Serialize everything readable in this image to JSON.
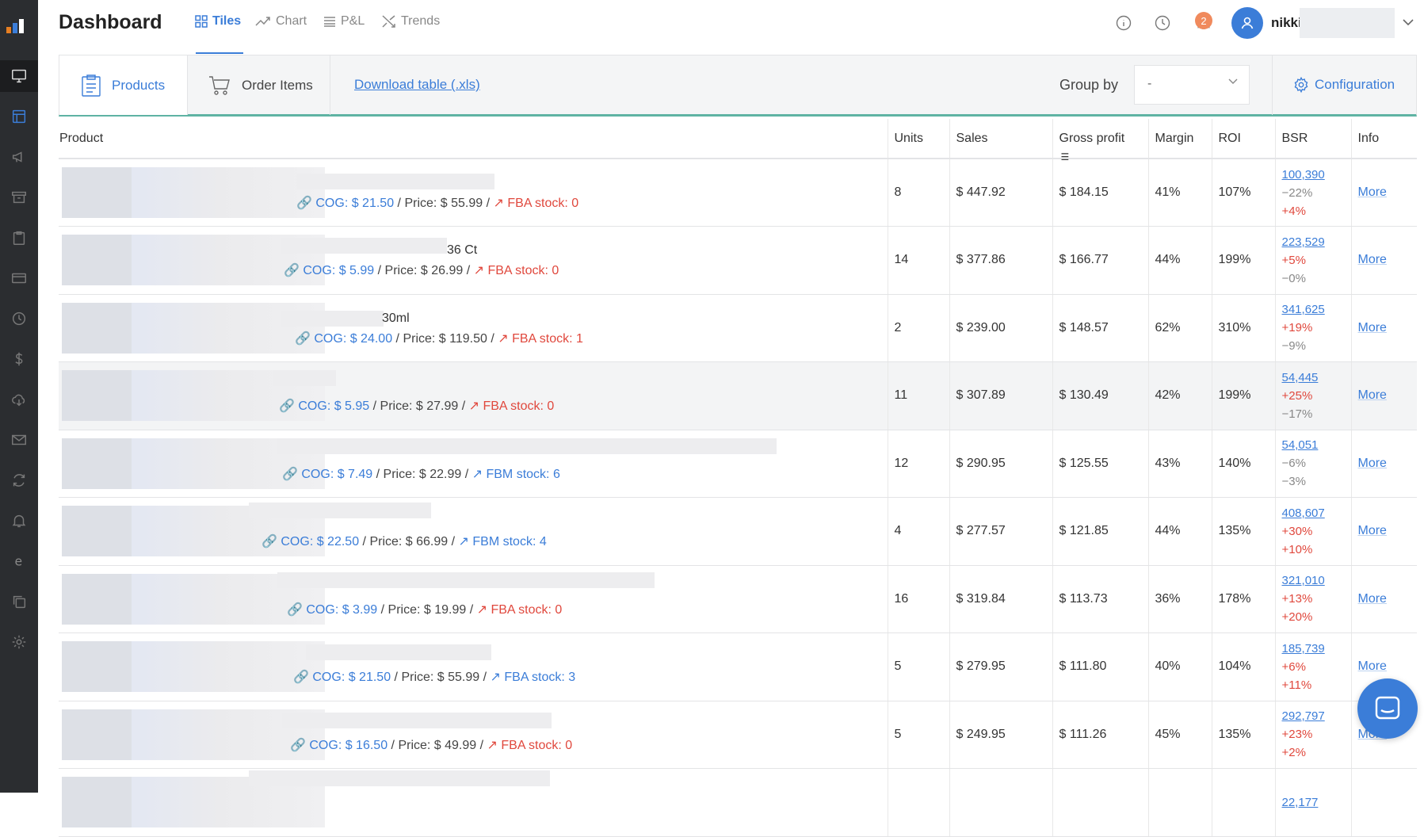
{
  "header": {
    "title": "Dashboard",
    "tabs": [
      {
        "label": "Tiles",
        "icon": "tiles-icon",
        "active": true
      },
      {
        "label": "Chart",
        "icon": "chart-icon"
      },
      {
        "label": "P&L",
        "icon": "list-icon"
      },
      {
        "label": "Trends",
        "icon": "trends-icon"
      }
    ],
    "notifications_count": "2",
    "user_name": "nikki"
  },
  "toolbar": {
    "tab_products": "Products",
    "tab_order_items": "Order Items",
    "download_label": "Download table (.xls)",
    "group_by_label": "Group by",
    "group_by_value": "-",
    "configuration_label": "Configuration"
  },
  "table": {
    "columns": [
      "Product",
      "Units",
      "Sales",
      "Gross profit",
      "Margin",
      "ROI",
      "BSR",
      "Info"
    ],
    "rows": [
      {
        "name_suffix": "",
        "cog": "COG: $ 21.50",
        "price": "/ Price: $ 55.99 /",
        "stock": "FBA stock: 0",
        "stock_color": "red",
        "units": "8",
        "sales": "$ 447.92",
        "gross": "$ 184.15",
        "margin": "41%",
        "roi": "107%",
        "bsr": "100,390",
        "bsr1": "−22%",
        "bsr2": "+4%",
        "info": "More"
      },
      {
        "name_suffix": "36 Ct",
        "cog": "COG: $ 5.99",
        "price": "/ Price: $ 26.99 /",
        "stock": "FBA stock: 0",
        "stock_color": "red",
        "units": "14",
        "sales": "$ 377.86",
        "gross": "$ 166.77",
        "margin": "44%",
        "roi": "199%",
        "bsr": "223,529",
        "bsr1": "+5%",
        "bsr2": "−0%",
        "info": "More"
      },
      {
        "name_suffix": "30ml",
        "cog": "COG: $ 24.00",
        "price": "/ Price: $ 119.50 /",
        "stock": "FBA stock: 1",
        "stock_color": "red",
        "units": "2",
        "sales": "$ 239.00",
        "gross": "$ 148.57",
        "margin": "62%",
        "roi": "310%",
        "bsr": "341,625",
        "bsr1": "+19%",
        "bsr2": "−9%",
        "info": "More"
      },
      {
        "name_suffix": "",
        "cog": "COG: $ 5.95",
        "price": "/ Price: $ 27.99 /",
        "stock": "FBA stock: 0",
        "stock_color": "red",
        "units": "11",
        "sales": "$ 307.89",
        "gross": "$ 130.49",
        "margin": "42%",
        "roi": "199%",
        "bsr": "54,445",
        "bsr1": "+25%",
        "bsr2": "−17%",
        "info": "More"
      },
      {
        "name_suffix": "",
        "cog": "COG: $ 7.49",
        "price": "/ Price: $ 22.99 /",
        "stock": "FBM stock: 6",
        "stock_color": "blue",
        "units": "12",
        "sales": "$ 290.95",
        "gross": "$ 125.55",
        "margin": "43%",
        "roi": "140%",
        "bsr": "54,051",
        "bsr1": "−6%",
        "bsr2": "−3%",
        "info": "More"
      },
      {
        "name_suffix": "",
        "cog": "COG: $ 22.50",
        "price": "/ Price: $ 66.99 /",
        "stock": "FBM stock: 4",
        "stock_color": "blue",
        "units": "4",
        "sales": "$ 277.57",
        "gross": "$ 121.85",
        "margin": "44%",
        "roi": "135%",
        "bsr": "408,607",
        "bsr1": "+30%",
        "bsr2": "+10%",
        "info": "More"
      },
      {
        "name_suffix": "",
        "cog": "COG: $ 3.99",
        "price": "/ Price: $ 19.99 /",
        "stock": "FBA stock: 0",
        "stock_color": "red",
        "units": "16",
        "sales": "$ 319.84",
        "gross": "$ 113.73",
        "margin": "36%",
        "roi": "178%",
        "bsr": "321,010",
        "bsr1": "+13%",
        "bsr2": "+20%",
        "info": "More"
      },
      {
        "name_suffix": "",
        "cog": "COG: $ 21.50",
        "price": "/ Price: $ 55.99 /",
        "stock": "FBA stock: 3",
        "stock_color": "blue",
        "units": "5",
        "sales": "$ 279.95",
        "gross": "$ 111.80",
        "margin": "40%",
        "roi": "104%",
        "bsr": "185,739",
        "bsr1": "+6%",
        "bsr2": "+11%",
        "info": "More"
      },
      {
        "name_suffix": "",
        "cog": "COG: $ 16.50",
        "price": "/ Price: $ 49.99 /",
        "stock": "FBA stock: 0",
        "stock_color": "red",
        "units": "5",
        "sales": "$ 249.95",
        "gross": "$ 111.26",
        "margin": "45%",
        "roi": "135%",
        "bsr": "292,797",
        "bsr1": "+23%",
        "bsr2": "+2%",
        "info": "More"
      },
      {
        "name_suffix": "",
        "cog": "",
        "price": "",
        "stock": "",
        "stock_color": "red",
        "units": "",
        "sales": "",
        "gross": "",
        "margin": "",
        "roi": "",
        "bsr": "22,177",
        "bsr1": "",
        "bsr2": "",
        "info": ""
      }
    ]
  },
  "sidebar": {
    "icons": [
      "monitor-icon",
      "layout-icon",
      "megaphone-icon",
      "archive-icon",
      "clipboard-icon",
      "card-icon",
      "clock-icon",
      "dollar-icon",
      "cloud-download-icon",
      "mail-icon",
      "refresh-icon",
      "bell-icon",
      "e-icon",
      "copy-icon",
      "gear-icon"
    ]
  },
  "colors": {
    "accent": "#3b7dd8",
    "red": "#e0483d",
    "teal": "#5fb3a3",
    "sidebar": "#2b2d30"
  }
}
